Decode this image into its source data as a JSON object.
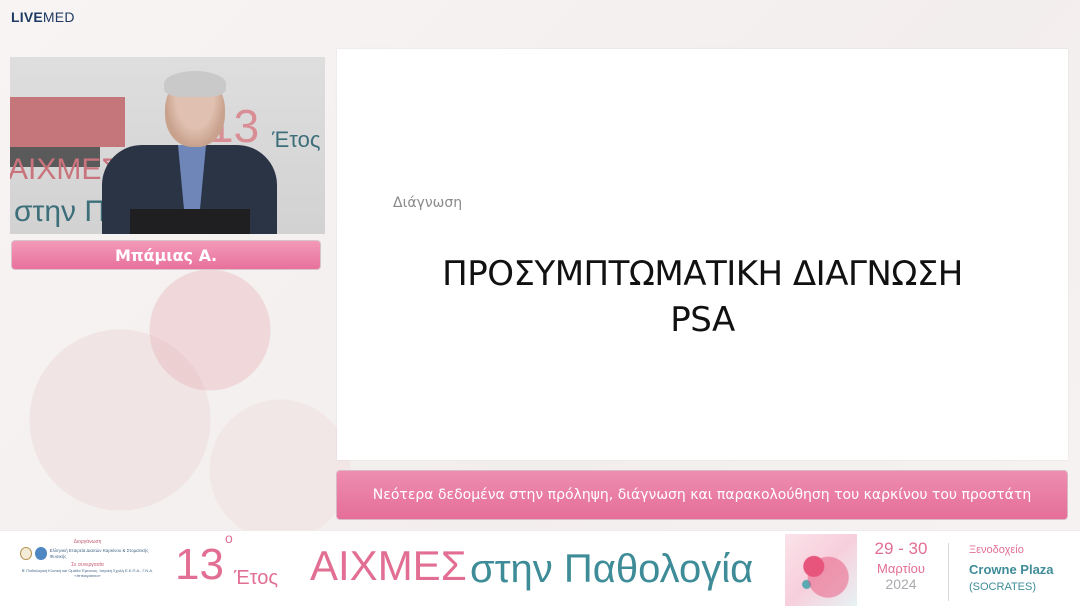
{
  "brand": {
    "live": "LIVE",
    "med": "MED"
  },
  "speaker": {
    "name": "Μπάμιας Α."
  },
  "video_backdrop": {
    "number": "13",
    "etos": "Έτος",
    "aixmes": "ΑΙΧΜΕΣ",
    "stin": "στην Π"
  },
  "slide": {
    "section": "Διάγνωση",
    "title_line1": "ΠΡΟΣΥΜΠΤΩΜΑΤΙΚΗ ΔΙΑΓΝΩΣΗ",
    "title_line2": "PSA"
  },
  "caption": "Νεότερα δεδομένα στην πρόληψη, διάγνωση και παρακολούθηση του καρκίνου του προστάτη",
  "banner": {
    "organizer_label": "Διοργάνωση",
    "organizer_name": "Ελληνική Εταιρεία Διαιτών Καρκίνου & Στοματικής Φυσικής",
    "collab_label": "Σε συνεργασία",
    "collab_name": "Β' Παθολογική Κλινική και Ομάδα Έρευνας, Ιατρική Σχολή Ε.Κ.Π.Α., Γ.Ν.Α. «Ιπποκράτειο»",
    "number": "13",
    "degree": "ο",
    "etos": "Έτος",
    "aixmes": "ΑΙΧΜΕΣ",
    "stin_pathologia": "στην Παθολογία",
    "dates": "29 - 30",
    "month": "Μαρτίου",
    "year": "2024",
    "venue_label": "Ξενοδοχείο",
    "venue_name": "Crowne Plaza",
    "venue_sub": "(SOCRATES)"
  }
}
